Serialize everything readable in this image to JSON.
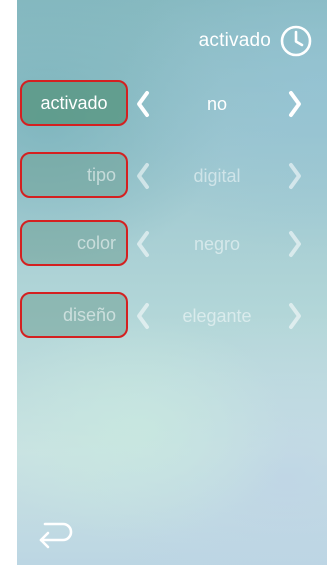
{
  "header": {
    "label": "activado",
    "icon": "clock-icon"
  },
  "rows": [
    {
      "label": "activado",
      "value": "no",
      "state": "active"
    },
    {
      "label": "tipo",
      "value": "digital",
      "state": "disabled"
    },
    {
      "label": "color",
      "value": "negro",
      "state": "disabled"
    },
    {
      "label": "diseño",
      "value": "elegante",
      "state": "disabled"
    }
  ],
  "icons": {
    "prev": "chevron-left-icon",
    "next": "chevron-right-icon",
    "back": "back-arrow-icon"
  },
  "colors": {
    "highlight_border": "#d42020",
    "text_active": "#ffffff"
  }
}
